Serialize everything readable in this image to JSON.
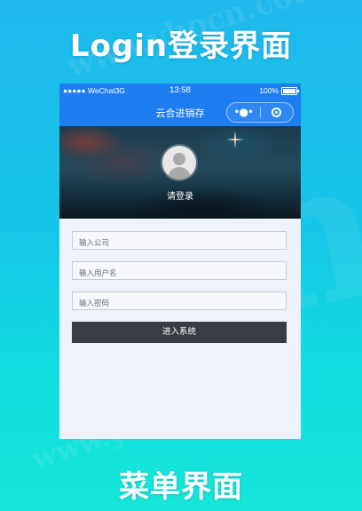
{
  "page": {
    "top_title": "Login登录界面",
    "bottom_title": "菜单界面"
  },
  "status_bar": {
    "signal": "●●●●● WeChat3G",
    "time": "13:58",
    "battery_percent": "100%"
  },
  "navbar": {
    "title": "云合进销存",
    "menu_glyph": "•●•",
    "accent_color": "#1e7df0"
  },
  "hero": {
    "login_hint": "请登录"
  },
  "form": {
    "company_placeholder": "输入公司",
    "username_placeholder": "输入用户名",
    "password_placeholder": "输入密码",
    "submit_label": "进入系统",
    "button_color": "#393c42"
  },
  "icons": [
    "avatar-icon",
    "battery-icon",
    "menu-dots-icon",
    "close-circle-icon"
  ]
}
